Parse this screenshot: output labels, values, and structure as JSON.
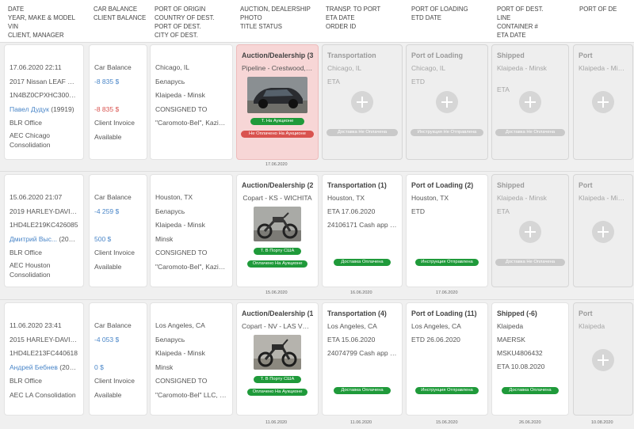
{
  "header": {
    "col1": [
      "DATE",
      "YEAR, MAKE & MODEL",
      "VIN",
      "CLIENT, MANAGER"
    ],
    "col2": [
      "CAR BALANCE",
      "CLIENT BALANCE"
    ],
    "col3": [
      "PORT OF ORIGIN",
      "COUNTRY OF DEST.",
      "PORT OF DEST.",
      "CITY OF DEST."
    ],
    "col4": [
      "AUCTION, DEALERSHIP",
      "PHOTO",
      "TITLE STATUS"
    ],
    "col5": [
      "TRANSP. TO PORT",
      "ETA DATE",
      "ORDER ID"
    ],
    "col6": [
      "PORT OF LOADING",
      "ETD DATE"
    ],
    "col7": [
      "PORT OF DEST.",
      "LINE",
      "CONTAINER #",
      "ETA DATE"
    ],
    "col8": [
      "PORT OF DE"
    ]
  },
  "rows": [
    {
      "info": {
        "date": "17.06.2020 22:11",
        "vehicle": "2017 Nissan LEAF SV F...",
        "vin": "1N4BZ0CPXHC300510",
        "client_name": "Павел Дудук",
        "client_id": "(19919)",
        "office": "BLR Office",
        "consolidation": "AEC Chicago Consolidation"
      },
      "balance": {
        "car_label": "Car Balance",
        "car_value": "-8 835 $",
        "car_value2": "-8 835 $",
        "client_label": "Client Invoice",
        "client_value": "Available"
      },
      "origin": {
        "port": "Chicago, IL",
        "country": "Беларусь",
        "dest": "Klaipeda - Minsk",
        "consigned": "CONSIGNED TO",
        "consignee": "\"Caromoto-Bel\", Kazints..."
      },
      "auction": {
        "title": "Auction/Dealership (3)",
        "sub": "Pipeline - Crestwood, IL",
        "status1": "Т. На Аукционе",
        "status2": "Не Оплачено На Аукционе",
        "date": "17.06.2020"
      },
      "transport": {
        "title": "Transportation",
        "line1": "Chicago, IL",
        "line2": "ETA",
        "status": "Доставка Не Оплачена"
      },
      "loading": {
        "title": "Port of Loading",
        "line1": "Chicago, IL",
        "line2": "ETD",
        "status": "Инструкция Не Отправлена"
      },
      "shipped": {
        "title": "Shipped",
        "line1": "Klaipeda - Minsk",
        "line2": "ETA",
        "status": "Доставка Не Оплачена"
      },
      "port": {
        "title": "Port",
        "line1": "Klaipeda - Minsk"
      }
    },
    {
      "info": {
        "date": "15.06.2020 21:07",
        "vehicle": "2019 HARLEY-DAVIDSO...",
        "vin": "1HD4LE219KC426085",
        "client_name": "Дмитрий Выс...",
        "client_id": "(20224)",
        "office": "BLR Office",
        "consolidation": "AEC Houston Consolidation"
      },
      "balance": {
        "car_label": "Car Balance",
        "car_value": "-4 259 $",
        "car_value2": "500 $",
        "client_label": "Client Invoice",
        "client_value": "Available"
      },
      "origin": {
        "port": "Houston, TX",
        "country": "Беларусь",
        "dest": "Klaipeda - Minsk",
        "city": "Minsk",
        "consigned": "CONSIGNED TO",
        "consignee": "\"Caromoto-Bel\", Kazints..."
      },
      "auction": {
        "title": "Auction/Dealership (2)",
        "sub": "Copart - KS - WICHITA",
        "status1": "Т. В Порту США",
        "status2": "Оплачено На Аукционе",
        "date": "15.06.2020"
      },
      "transport": {
        "title": "Transportation (1)",
        "line1": "Houston, TX",
        "line2": "ETA 17.06.2020",
        "line3": "24106171 Cash app 28...",
        "status": "Доставка Оплачена",
        "date": "16.06.2020"
      },
      "loading": {
        "title": "Port of Loading (2)",
        "line1": "Houston, TX",
        "line2": "ETD",
        "status": "Инструкция Отправлена",
        "date": "17.06.2020"
      },
      "shipped": {
        "title": "Shipped",
        "line1": "Klaipeda - Minsk",
        "line2": "ETA",
        "status": "Доставка Не Оплачена"
      },
      "port": {
        "title": "Port",
        "line1": "Klaipeda - Minsk"
      }
    },
    {
      "info": {
        "date": "11.06.2020 23:41",
        "vehicle": "2015 HARLEY-DAVIDSO...",
        "vin": "1HD4LE213FC440618",
        "client_name": "Андрей Бебнев",
        "client_id": "(20223)",
        "office": "BLR Office",
        "consolidation": "AEC LA Consolidation"
      },
      "balance": {
        "car_label": "Car Balance",
        "car_value": "-4 053 $",
        "car_value2": "0 $",
        "client_label": "Client Invoice",
        "client_value": "Available"
      },
      "origin": {
        "port": "Los Angeles, CA",
        "country": "Беларусь",
        "dest": "Klaipeda - Minsk",
        "city": "Minsk",
        "consigned": "CONSIGNED TO",
        "consignee": "\"Caromoto-Bel\" LLC, Ka..."
      },
      "auction": {
        "title": "Auction/Dealership (1)",
        "sub": "Copart - NV - LAS VEGAS",
        "status1": "Т. В Порту США",
        "status2": "Оплачено На Аукционе",
        "date": "11.06.2020"
      },
      "transport": {
        "title": "Transportation (4)",
        "line1": "Los Angeles, CA",
        "line2": "ETA 15.06.2020",
        "line3": "24074799 Cash app $ju...",
        "status": "Доставка Оплачена",
        "date": "11.06.2020"
      },
      "loading": {
        "title": "Port of Loading (11)",
        "line1": "Los Angeles, CA",
        "line2": "ETD 26.06.2020",
        "status": "Инструкция Отправлена",
        "date": "15.06.2020"
      },
      "shipped": {
        "title": "Shipped (-6)",
        "line1": "Klaipeda",
        "line2": "MAERSK",
        "line3": "MSKU4806432",
        "line4": "ETA 10.08.2020",
        "status": "Доставка Оплачена",
        "date": "26.06.2020"
      },
      "port": {
        "title": "Port",
        "line1": "Klaipeda",
        "date": "10.08.2020"
      }
    }
  ],
  "colors": {
    "accent_blue": "#4a86c8",
    "negative_red": "#d9534f",
    "status_green": "#1f9a3a",
    "pink_card": "#f7d6d6",
    "gray_card": "#eeeeee"
  }
}
